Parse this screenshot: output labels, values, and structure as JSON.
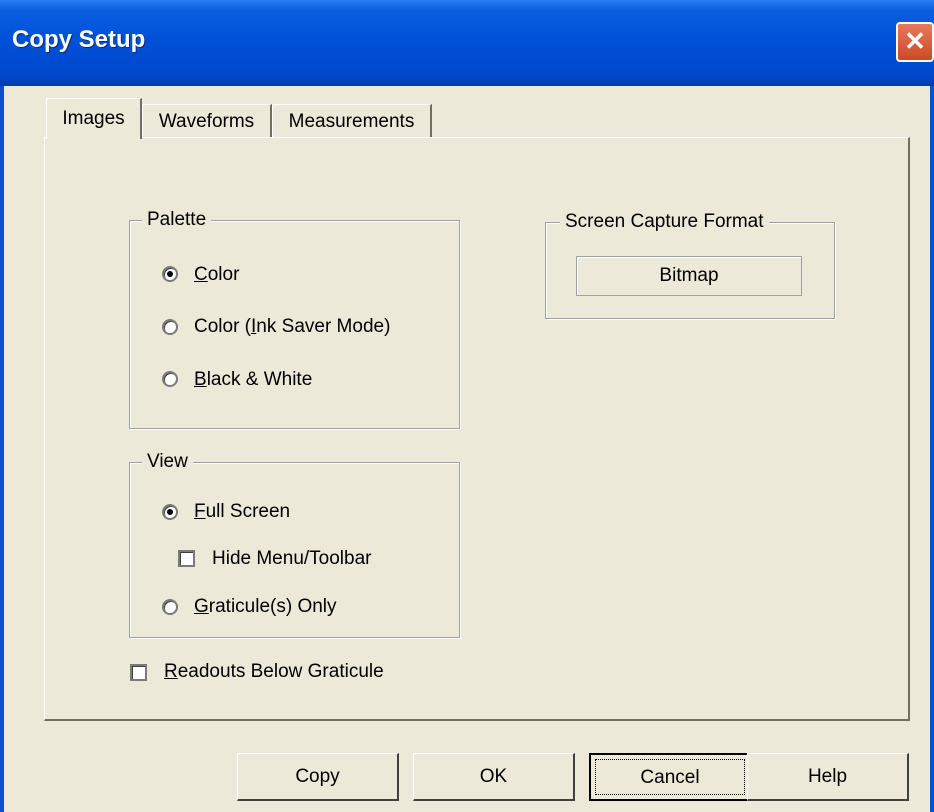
{
  "window": {
    "title": "Copy Setup",
    "close_glyph": "✕"
  },
  "tabs": [
    {
      "label": "Images",
      "active": true
    },
    {
      "label": "Waveforms",
      "active": false
    },
    {
      "label": "Measurements",
      "active": false
    }
  ],
  "palette": {
    "legend": "Palette",
    "options": [
      {
        "label_mnemonic": "C",
        "label_rest": "olor",
        "checked": true
      },
      {
        "label_pre": "Color (",
        "label_mnemonic": "I",
        "label_post": "nk Saver Mode)",
        "checked": false
      },
      {
        "label_mnemonic": "B",
        "label_rest": "lack & White",
        "checked": false
      }
    ]
  },
  "screen_capture": {
    "legend": "Screen Capture Format",
    "value": "Bitmap"
  },
  "view": {
    "legend": "View",
    "full_screen": {
      "label_mnemonic": "F",
      "label_rest": "ull Screen",
      "checked": true
    },
    "hide_menu": {
      "label": "Hide Menu/Toolbar",
      "checked": false
    },
    "graticule": {
      "label_mnemonic": "G",
      "label_rest": "raticule(s) Only",
      "checked": false
    }
  },
  "readouts": {
    "label_mnemonic": "R",
    "label_rest": "eadouts Below Graticule",
    "checked": false
  },
  "buttons": {
    "copy": "Copy",
    "ok": "OK",
    "cancel": "Cancel",
    "help": "Help"
  },
  "colors": {
    "titlebar": "#0050d8",
    "dialog_bg": "#ece9d8",
    "close_button": "#d95a36"
  }
}
